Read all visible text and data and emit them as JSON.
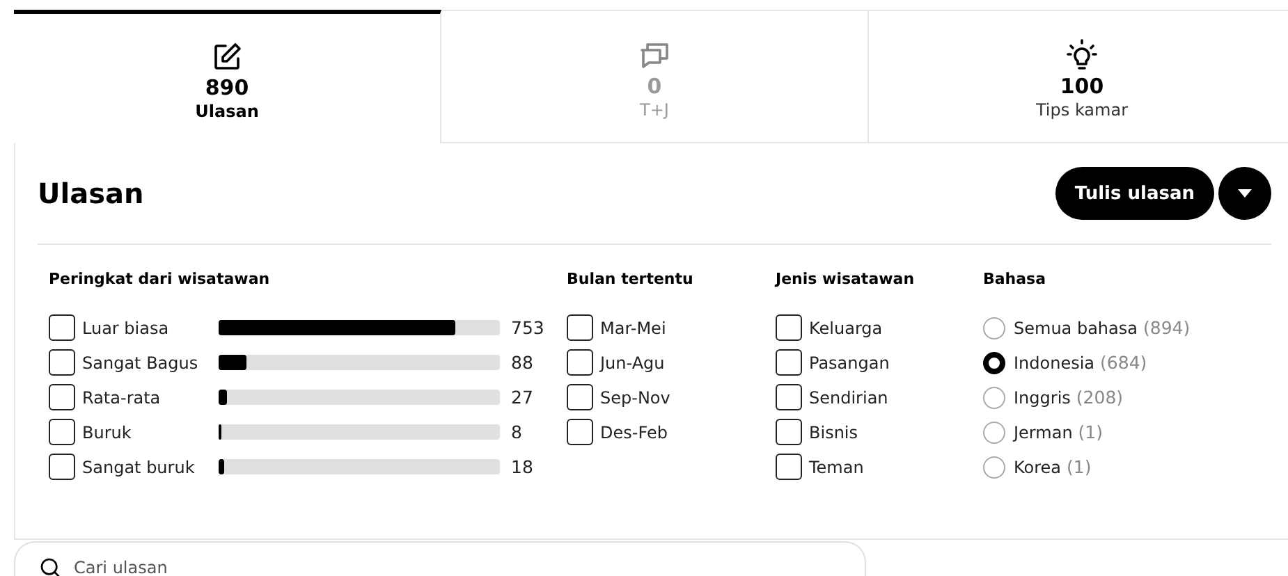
{
  "tabs": [
    {
      "kind": "edit",
      "count": "890",
      "label": "Ulasan",
      "selected": true,
      "disabled": false
    },
    {
      "kind": "chat",
      "count": "0",
      "label": "T+J",
      "selected": false,
      "disabled": true
    },
    {
      "kind": "bulb",
      "count": "100",
      "label": "Tips kamar",
      "selected": false,
      "disabled": false
    }
  ],
  "section": {
    "title": "Ulasan",
    "write_button": "Tulis ulasan"
  },
  "ratings": {
    "heading": "Peringkat dari wisatawan",
    "items": [
      {
        "label": "Luar biasa",
        "checked": false,
        "level": 0.84,
        "count": "753"
      },
      {
        "label": "Sangat Bagus",
        "checked": false,
        "level": 0.1,
        "count": "88"
      },
      {
        "label": "Rata-rata",
        "checked": false,
        "level": 0.03,
        "count": "27"
      },
      {
        "label": "Buruk",
        "checked": false,
        "level": 0.008,
        "count": "8"
      },
      {
        "label": "Sangat buruk",
        "checked": false,
        "level": 0.02,
        "count": "18"
      }
    ]
  },
  "months": {
    "heading": "Bulan tertentu",
    "items": [
      {
        "label": "Mar-Mei",
        "checked": false
      },
      {
        "label": "Jun-Agu",
        "checked": false
      },
      {
        "label": "Sep-Nov",
        "checked": false
      },
      {
        "label": "Des-Feb",
        "checked": false
      }
    ]
  },
  "traveler_types": {
    "heading": "Jenis wisatawan",
    "items": [
      {
        "label": "Keluarga",
        "checked": false
      },
      {
        "label": "Pasangan",
        "checked": false
      },
      {
        "label": "Sendirian",
        "checked": false
      },
      {
        "label": "Bisnis",
        "checked": false
      },
      {
        "label": "Teman",
        "checked": false
      }
    ]
  },
  "languages": {
    "heading": "Bahasa",
    "items": [
      {
        "label": "Semua bahasa",
        "count": "(894)",
        "selected": false
      },
      {
        "label": "Indonesia",
        "count": "(684)",
        "selected": true
      },
      {
        "label": "Inggris",
        "count": "(208)",
        "selected": false
      },
      {
        "label": "Jerman",
        "count": "(1)",
        "selected": false
      },
      {
        "label": "Korea",
        "count": "(1)",
        "selected": false
      }
    ]
  },
  "search": {
    "placeholder": "Cari ulasan"
  }
}
